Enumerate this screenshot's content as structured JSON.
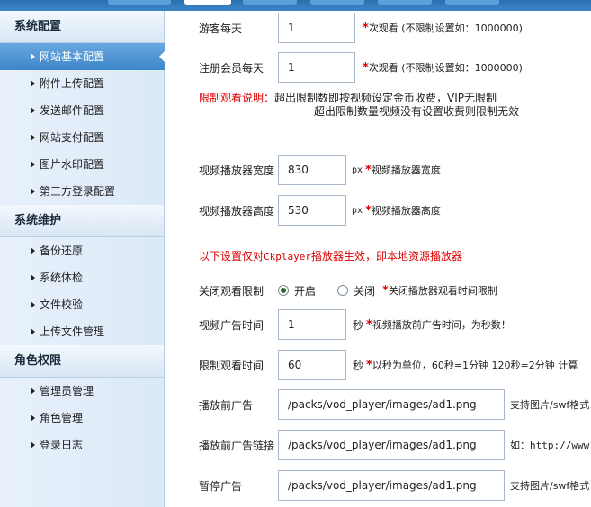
{
  "sidebar": {
    "groups": [
      {
        "title": "系统配置",
        "items": [
          "网站基本配置",
          "附件上传配置",
          "发送邮件配置",
          "网站支付配置",
          "图片水印配置",
          "第三方登录配置"
        ]
      },
      {
        "title": "系统维护",
        "items": [
          "备份还原",
          "系统体检",
          "文件校验",
          "上传文件管理"
        ]
      },
      {
        "title": "角色权限",
        "items": [
          "管理员管理",
          "角色管理",
          "登录日志"
        ]
      }
    ],
    "active_item": "网站基本配置"
  },
  "form": {
    "guest": {
      "label": "游客每天",
      "value": "1",
      "hint": "次观看 (不限制设置如：1000000)"
    },
    "member": {
      "label": "注册会员每天",
      "value": "1",
      "hint": "次观看 (不限制设置如：1000000)"
    },
    "limit_note": {
      "title": "限制观看说明：",
      "line1": "超出限制数即按视频设定金币收费，VIP无限制",
      "line2": "超出限制数量视频没有设置收费则限制无效"
    },
    "width": {
      "label": "视频播放器宽度",
      "value": "830",
      "unit": "px",
      "hint": "视频播放器宽度"
    },
    "height": {
      "label": "视频播放器高度",
      "value": "530",
      "unit": "px",
      "hint": "视频播放器高度"
    },
    "ck_note": {
      "prefix": "以下设置仅对",
      "brand": "Ckplayer",
      "suffix": "播放器生效，即本地资源播放器"
    },
    "close_limit": {
      "label": "关闭观看限制",
      "on_label": "开启",
      "off_label": "关闭",
      "hint": "关闭播放器观看时间限制"
    },
    "ad_time": {
      "label": "视频广告时间",
      "value": "1",
      "unit": "秒",
      "hint": "视频播放前广告时间，为秒数！"
    },
    "limit_time": {
      "label": "限制观看时间",
      "value": "60",
      "unit": "秒",
      "hint": "以秒为单位，60秒=1分钟  120秒=2分钟 计算"
    },
    "pre_ad": {
      "label": "播放前广告",
      "value": "/packs/vod_player/images/ad1.png",
      "hint": "支持图片/swf格式"
    },
    "pre_ad_link": {
      "label": "播放前广告链接",
      "value": "/packs/vod_player/images/ad1.png",
      "hint": "如：http://www."
    },
    "pause_ad": {
      "label": "暂停广告",
      "value": "/packs/vod_player/images/ad1.png",
      "hint": "支持图片/swf格式"
    }
  }
}
